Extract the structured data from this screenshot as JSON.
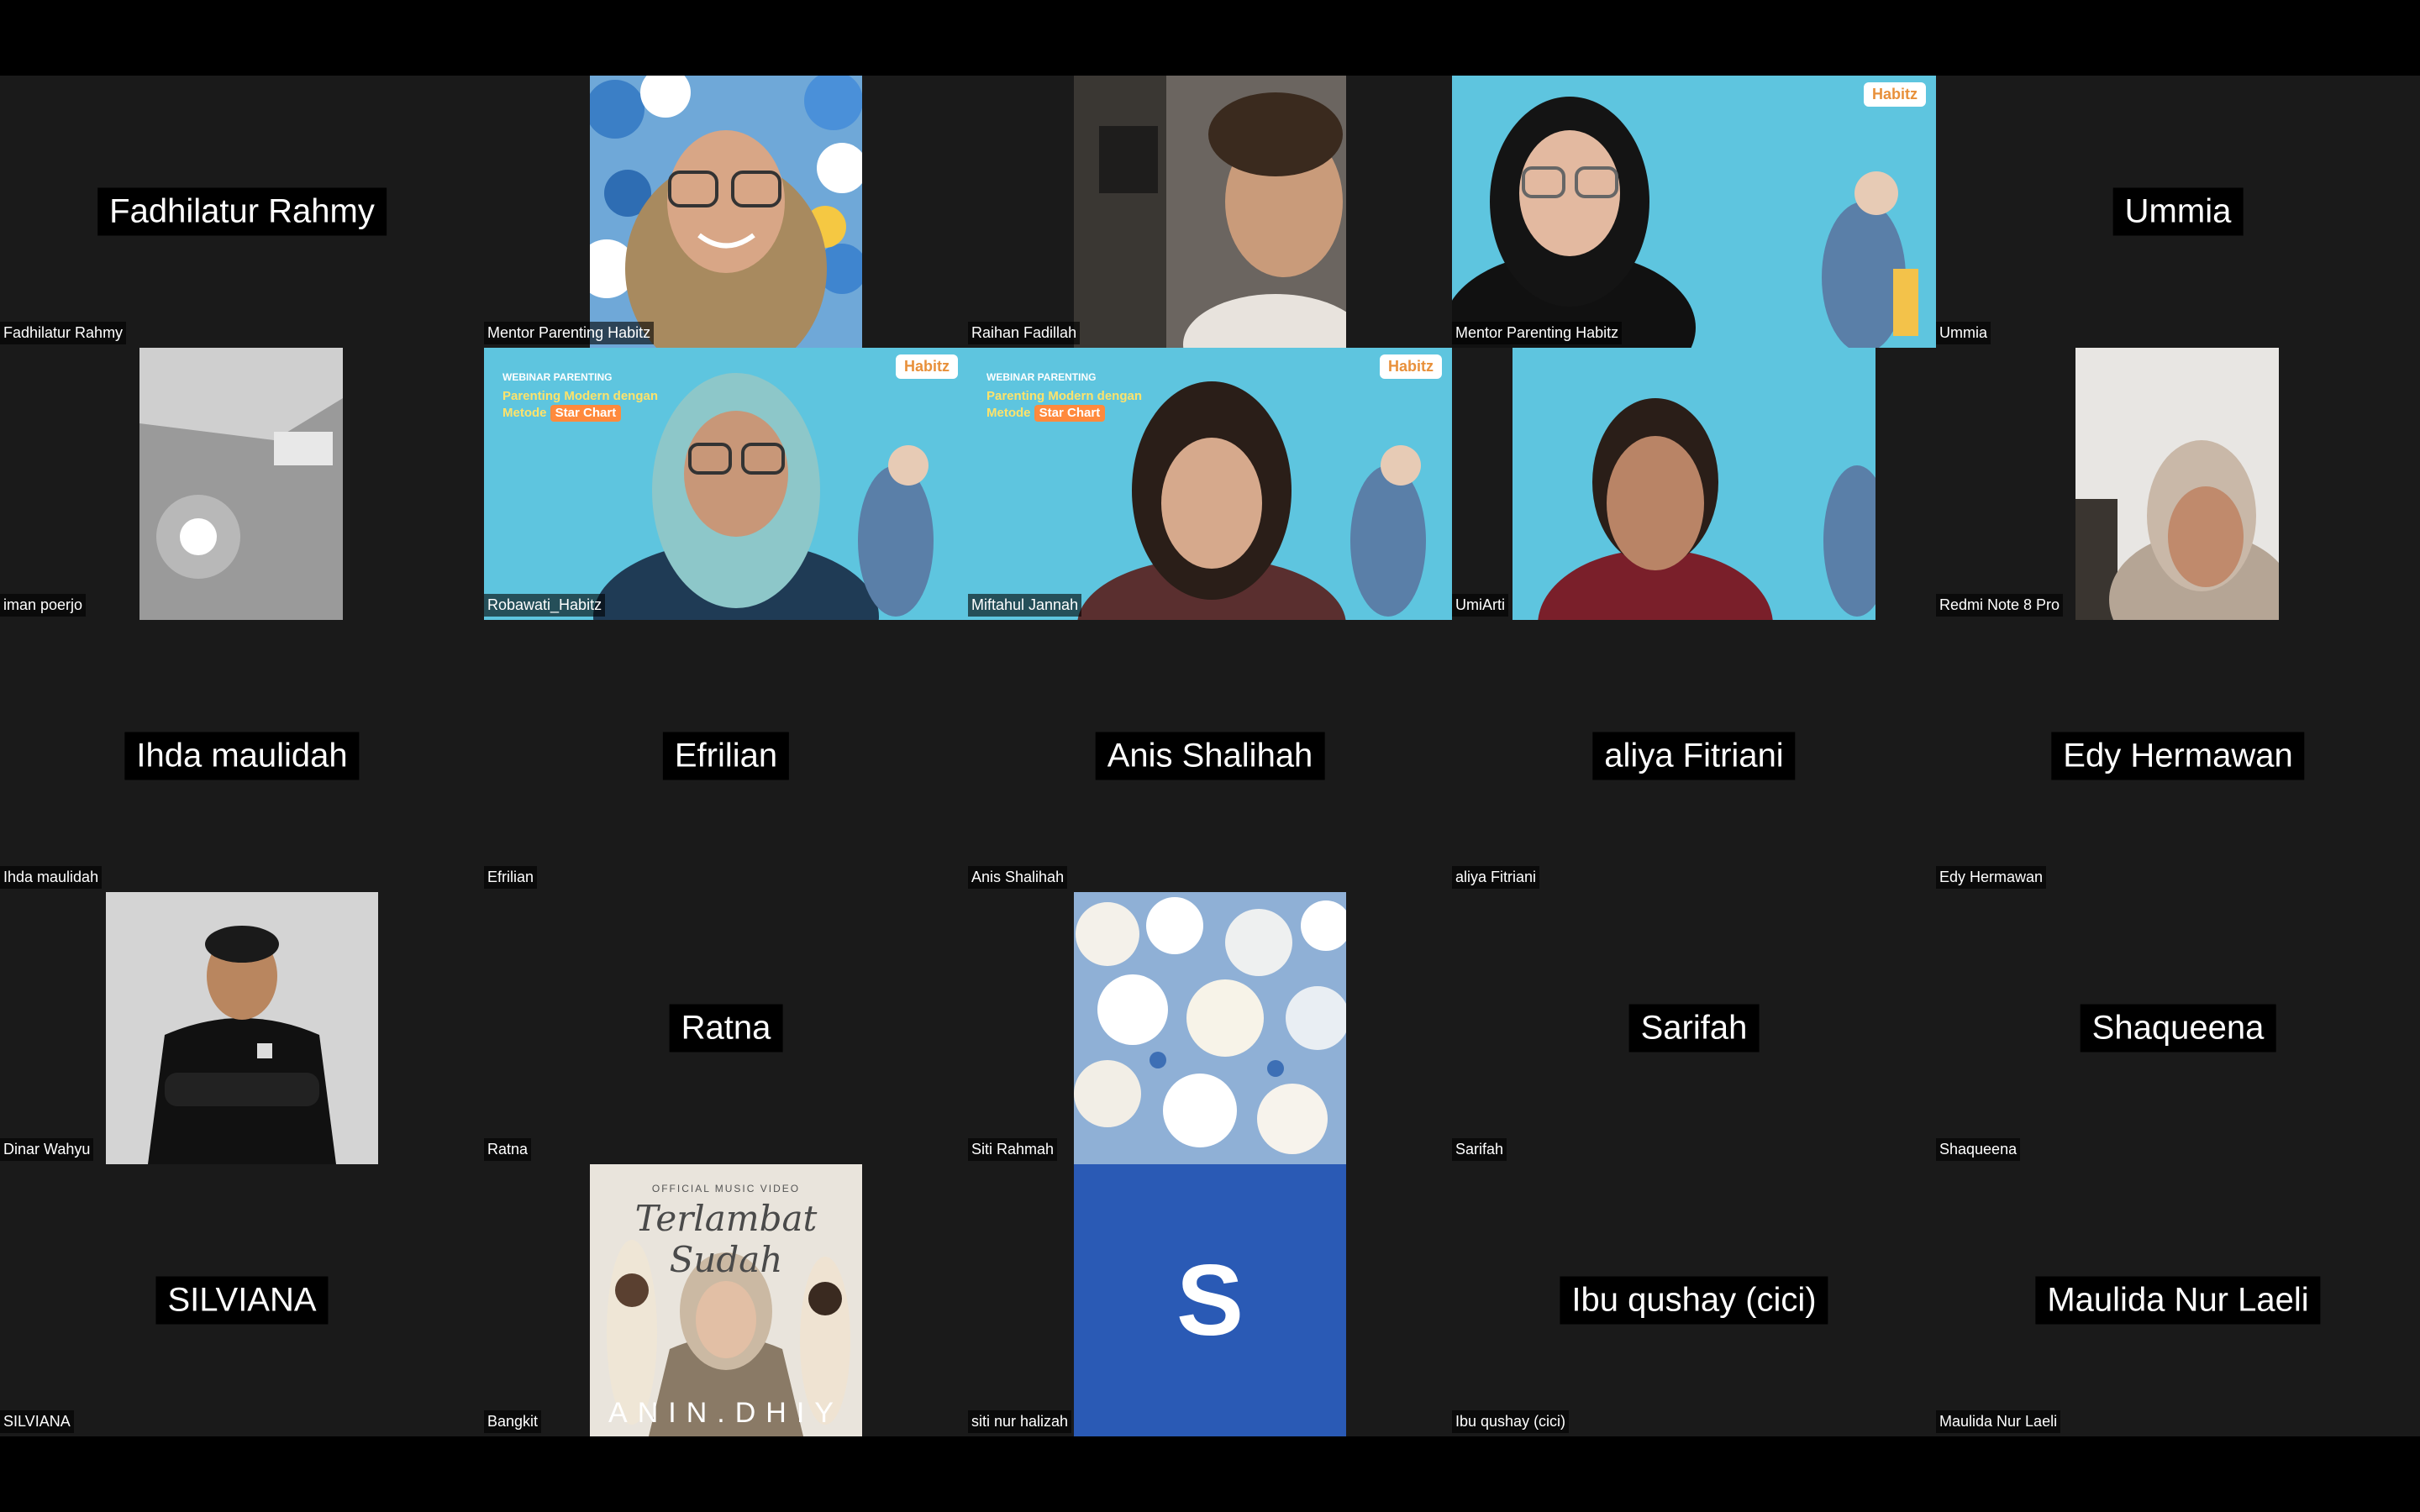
{
  "tiles": [
    {
      "name": "Fadhilatur Rahmy",
      "label": "Fadhilatur Rahmy",
      "type": "name"
    },
    {
      "name": "Mentor Parenting Habitz",
      "type": "video"
    },
    {
      "name": "Raihan Fadillah",
      "type": "video"
    },
    {
      "name": "Mentor Parenting Habitz",
      "type": "video"
    },
    {
      "name": "Ummia",
      "label": "Ummia",
      "type": "name"
    },
    {
      "name": "iman poerjo",
      "type": "video"
    },
    {
      "name": "Robawati_Habitz",
      "type": "video"
    },
    {
      "name": "Miftahul Jannah",
      "type": "video"
    },
    {
      "name": "UmiArti",
      "type": "video"
    },
    {
      "name": "Redmi Note 8 Pro",
      "type": "video"
    },
    {
      "name": "Ihda maulidah",
      "label": "Ihda maulidah",
      "type": "name"
    },
    {
      "name": "Efrilian",
      "label": "Efrilian",
      "type": "name"
    },
    {
      "name": "Anis Shalihah",
      "label": "Anis Shalihah",
      "type": "name"
    },
    {
      "name": "aliya Fitriani",
      "label": "aliya Fitriani",
      "type": "name"
    },
    {
      "name": "Edy Hermawan",
      "label": "Edy Hermawan",
      "type": "name"
    },
    {
      "name": "Dinar Wahyu",
      "type": "video"
    },
    {
      "name": "Ratna",
      "label": "Ratna",
      "type": "name"
    },
    {
      "name": "Siti Rahmah",
      "type": "video"
    },
    {
      "name": "Sarifah",
      "label": "Sarifah",
      "type": "name"
    },
    {
      "name": "Shaqueena",
      "label": "Shaqueena",
      "type": "name"
    },
    {
      "name": "SILVIANA",
      "label": "SILVIANA",
      "type": "name"
    },
    {
      "name": "Bangkit",
      "type": "video"
    },
    {
      "name": "siti nur halizah",
      "type": "avatar",
      "avatar_letter": "S"
    },
    {
      "name": "Ibu qushay (cici)",
      "label": "Ibu qushay (cici)",
      "type": "name"
    },
    {
      "name": "Maulida Nur Laeli",
      "label": "Maulida Nur Laeli",
      "type": "name"
    }
  ],
  "habitz_bg": {
    "logo": "Habitz",
    "webinar": "WEBINAR PARENTING",
    "title_line1": "Parenting Modern dengan",
    "title_line2": "Metode",
    "chip": "Star Chart"
  },
  "music_video": {
    "top": "OFFICIAL MUSIC VIDEO",
    "title": "Terlambat Sudah",
    "bottom": "ANIN.DHIY"
  },
  "colors": {
    "tile_bg": "#1a1a1a",
    "habitz_blue": "#5ec5df",
    "avatar_blue": "#2a5ab5"
  }
}
